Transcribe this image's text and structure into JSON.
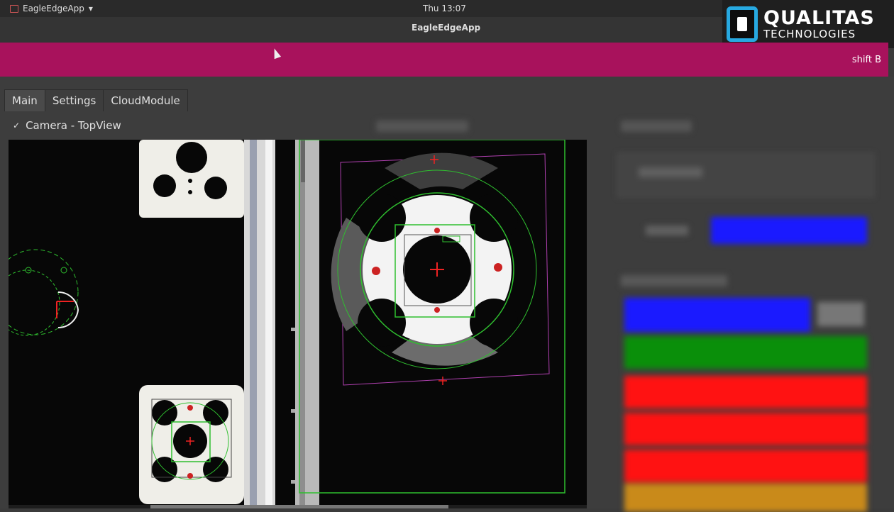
{
  "system": {
    "app_name": "EagleEdgeApp",
    "clock": "Thu 13:07"
  },
  "window": {
    "title": "EagleEdgeApp"
  },
  "logo": {
    "line1": "QUALITAS",
    "line2": "TECHNOLOGIES"
  },
  "status": {
    "shift": "shift B",
    "bar_color": "#a8125c"
  },
  "tabs": [
    {
      "label": "Main"
    },
    {
      "label": "Settings"
    },
    {
      "label": "CloudModule"
    }
  ],
  "section": {
    "check": "✓",
    "title": "Camera - TopView"
  },
  "colors": {
    "blue": "#1a1aff",
    "green": "#0a8f0a",
    "red": "#ff1212",
    "orange": "#c98a1a"
  }
}
